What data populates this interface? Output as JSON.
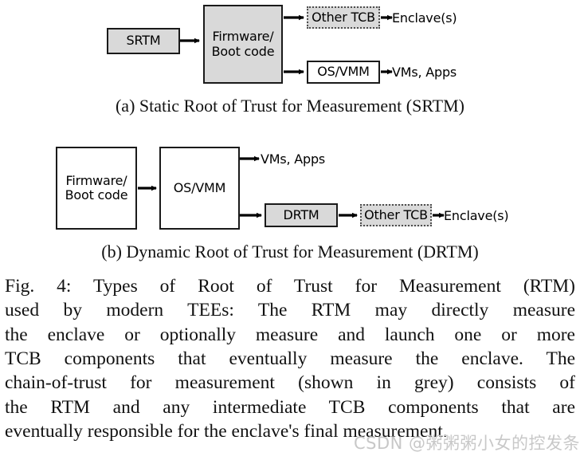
{
  "figure": {
    "main_caption_lines": [
      "Fig. 4: Types of Root of Trust for Measurement (RTM)",
      "used by modern TEEs: The RTM may directly measure",
      "the enclave or optionally measure and launch one or more",
      "TCB components that eventually measure the enclave. The",
      "chain-of-trust for measurement (shown in grey) consists of",
      "the RTM and any intermediate TCB components that are",
      "eventually responsible for the enclave's final measurement."
    ],
    "colors": {
      "grey_fill": "#d9d9d9",
      "white_fill": "#ffffff",
      "stroke": "#1a1a1a",
      "dotted_stroke": "#4d4d4d",
      "watermark": "#c8c8c8"
    }
  },
  "diagram_a": {
    "caption": "(a) Static Root of Trust for Measurement (SRTM)",
    "nodes": {
      "srtm": "SRTM",
      "firmware_line1": "Firmware/",
      "firmware_line2": "Boot code",
      "other_tcb": "Other TCB",
      "os_vmm": "OS/VMM"
    },
    "labels": {
      "enclaves": "Enclave(s)",
      "vms_apps": "VMs, Apps"
    }
  },
  "diagram_b": {
    "caption": "(b) Dynamic Root of Trust for Measurement (DRTM)",
    "nodes": {
      "firmware_line1": "Firmware/",
      "firmware_line2": "Boot code",
      "os_vmm": "OS/VMM",
      "drtm": "DRTM",
      "other_tcb": "Other TCB"
    },
    "labels": {
      "vms_apps": "VMs, Apps",
      "enclaves": "Enclave(s)"
    }
  },
  "watermark": {
    "text": "CSDN @粥粥粥小女的控发条鸟"
  }
}
